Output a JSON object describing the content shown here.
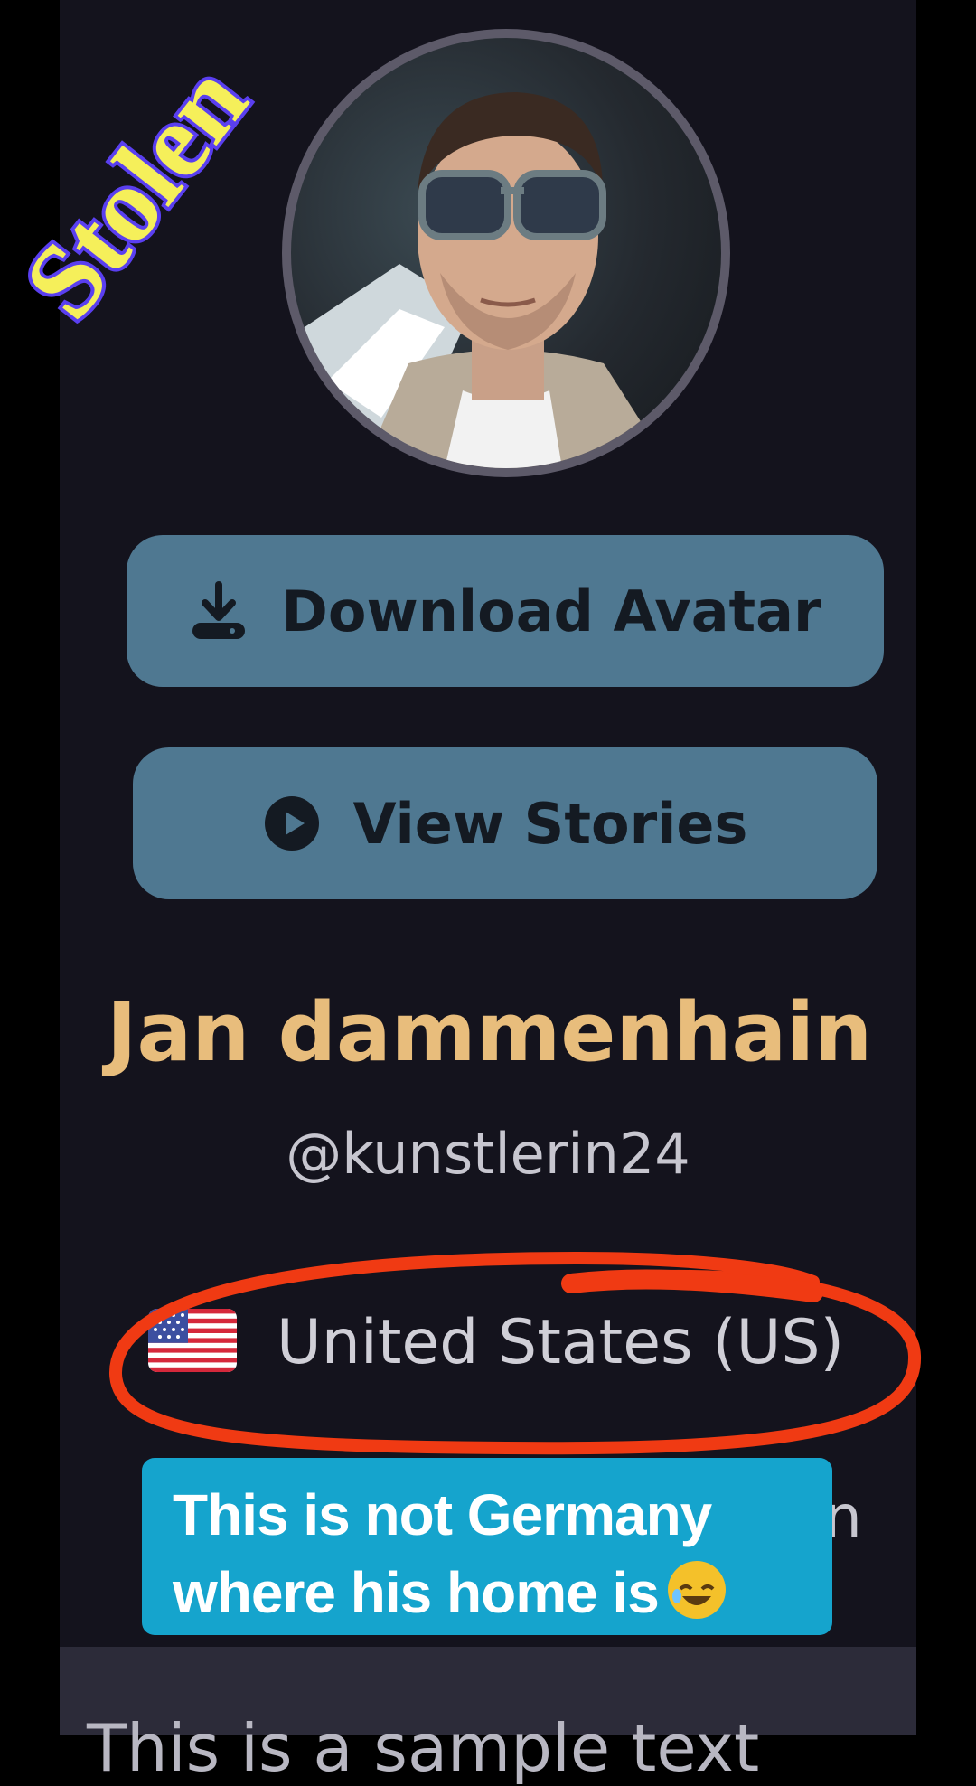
{
  "overlay": {
    "stamp_text": "Stolen",
    "caption_lines": [
      "This is not Germany",
      "where  his home is"
    ],
    "caption_emoji": "rolling-on-floor-laughing-emoji"
  },
  "profile": {
    "avatar_alt": "profile avatar",
    "display_name": "Jan dammenhain",
    "username": "@kunstlerin24",
    "country_flag": "us-flag-icon",
    "country": "United States (US)"
  },
  "actions": {
    "download_avatar_label": "Download Avatar",
    "view_stories_label": "View Stories"
  },
  "partial": {
    "right_glyph": "n",
    "bottom_text": "This is a sample text"
  },
  "colors": {
    "background": "#14131d",
    "button": "#4f7891",
    "name": "#e8bd7c",
    "annotation": "#f03a13",
    "caption_bg": "#15a4cd"
  }
}
